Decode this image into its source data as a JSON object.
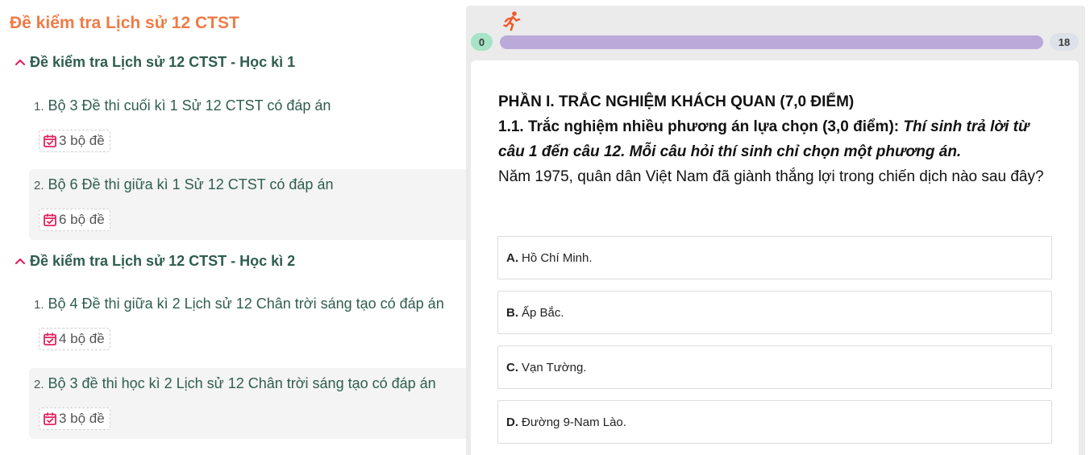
{
  "left": {
    "page_title": "Đề kiểm tra Lịch sử 12 CTST",
    "sections": [
      {
        "title": "Đề kiểm tra Lịch sử 12 CTST - Học kì 1",
        "items": [
          {
            "num": "1.",
            "title": "Bộ 3 Đề thi cuối kì 1 Sử 12 CTST có đáp án",
            "badge": "3 bộ đề"
          },
          {
            "num": "2.",
            "title": "Bộ 6 Đề thi giữa kì 1 Sử 12 CTST có đáp án",
            "badge": "6 bộ đề"
          }
        ]
      },
      {
        "title": "Đề kiểm tra Lịch sử 12 CTST - Học kì 2",
        "items": [
          {
            "num": "1.",
            "title": "Bộ 4 Đề thi giữa kì 2 Lịch sử 12 Chân trời sáng tạo có đáp án",
            "badge": "4 bộ đề"
          },
          {
            "num": "2.",
            "title": "Bộ 3 đề thi học kì 2 Lịch sử 12 Chân trời sáng tạo có đáp án",
            "badge": "3 bộ đề"
          }
        ]
      }
    ]
  },
  "quiz": {
    "progress": {
      "start_label": "0",
      "end_label": "18",
      "fraction": 1.0
    },
    "part_title": "PHẦN I. TRẮC NGHIỆM KHÁCH QUAN (7,0 ĐIỂM)",
    "sub_title_bold": "1.1. Trắc nghiệm nhiều phương án lựa chọn (3,0 điểm):",
    "sub_title_italic": "Thí sinh trả lời từ câu 1 đến câu 12. Mỗi câu hỏi thí sinh chỉ chọn một phương án.",
    "question": "Năm 1975, quân dân Việt Nam đã giành thắng lợi trong chiến dịch nào sau đây?",
    "options": [
      {
        "letter": "A.",
        "text": "Hồ Chí Minh."
      },
      {
        "letter": "B.",
        "text": "Ấp Bắc."
      },
      {
        "letter": "C.",
        "text": "Vạn Tường."
      },
      {
        "letter": "D.",
        "text": "Đường 9-Nam Lào."
      }
    ]
  },
  "icons": {
    "section_toggle": "chevron-up-icon",
    "badge": "calendar-check-icon",
    "progress_marker": "running-person-icon"
  },
  "colors": {
    "title_orange": "#ef7b45",
    "heading_green": "#2f5d50",
    "badge_icon": "#e0245e",
    "progress_fill": "#bba9da",
    "start_pill": "#a6e3c7",
    "runner": "#f05a28"
  }
}
